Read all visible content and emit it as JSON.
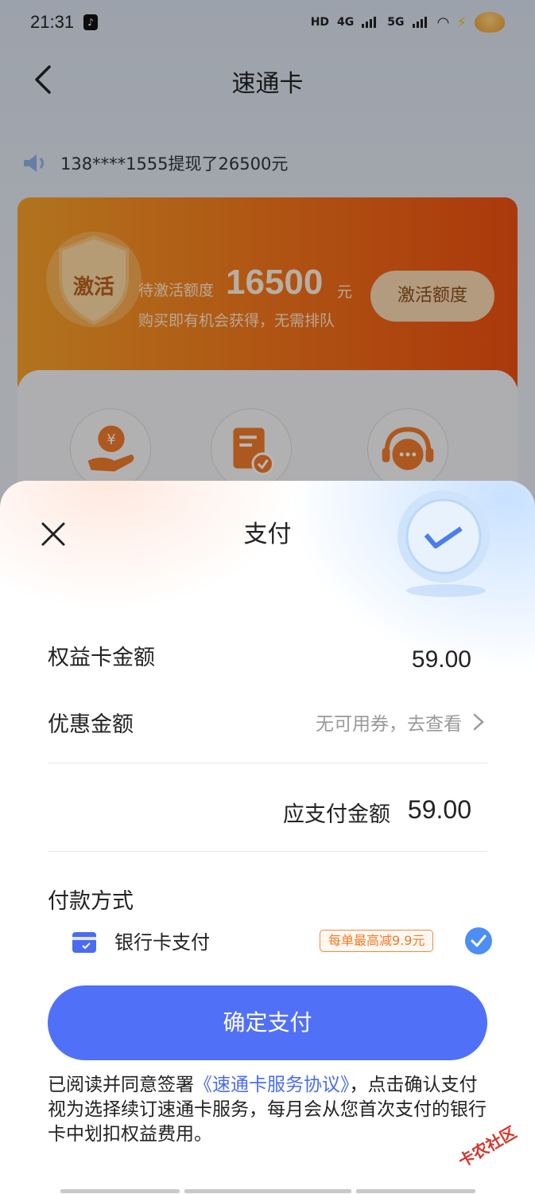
{
  "status_bar": {
    "time": "21:31",
    "network_labels": [
      "HD",
      "4G",
      "5G"
    ]
  },
  "nav": {
    "title": "速通卡"
  },
  "notice": {
    "text": "138****1555提现了26500元"
  },
  "promo": {
    "badge_text": "激活",
    "label": "待激活额度",
    "amount": "16500",
    "unit": "元",
    "subtitle": "购买即有机会获得，无需排队",
    "button_label": "激活额度"
  },
  "payment_sheet": {
    "title": "支付",
    "card_amount_label": "权益卡金额",
    "card_amount_value": "59.00",
    "discount_label": "优惠金额",
    "discount_link": "无可用券，去查看",
    "total_label": "应支付金额",
    "total_value": "59.00",
    "method_title": "付款方式",
    "bank_method_label": "银行卡支付",
    "bank_discount_badge": "每单最高减9.9元",
    "confirm_button": "确定支付",
    "agreement_prefix": "已阅读并同意签署",
    "agreement_link": "《速通卡服务协议》",
    "agreement_suffix": "，点击确认支付视为选择续订速通卡服务，每月会从您首次支付的银行卡中划扣权益费用。"
  },
  "watermark": {
    "text": "卡农社区"
  },
  "colors": {
    "primary": "#5070f7",
    "promo_orange": "#f47a1d",
    "badge_orange": "#ee7a2a",
    "check_blue": "#4d8ef5"
  }
}
